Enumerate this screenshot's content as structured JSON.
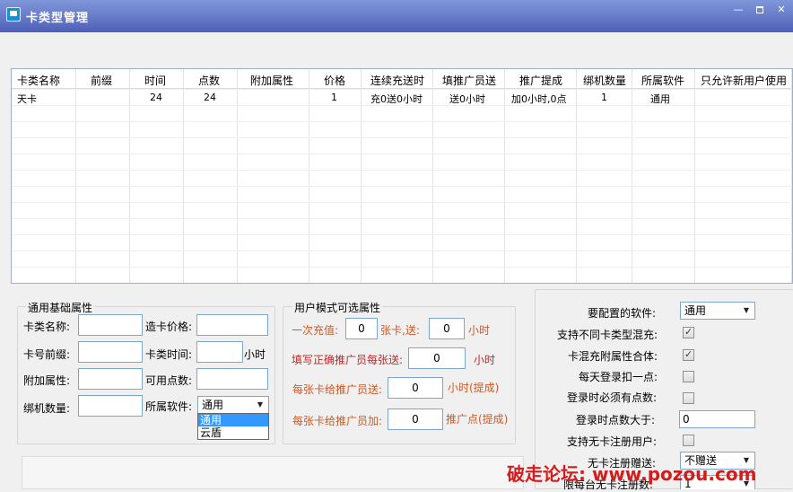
{
  "window": {
    "title": "卡类型管理",
    "min_glyph": "—",
    "close_glyph": "✕"
  },
  "grid": {
    "columns": [
      "卡类名称",
      "前缀",
      "时间",
      "点数",
      "附加属性",
      "价格",
      "连续充送时",
      "填推广员送",
      "推广提成",
      "绑机数量",
      "所属软件",
      "只允许新用户使用"
    ],
    "rows": [
      [
        "天卡",
        "",
        "24",
        "24",
        "",
        "1",
        "充0送0小时",
        "送0小时",
        "加0小时,0点",
        "1",
        "通用",
        ""
      ]
    ]
  },
  "basic": {
    "title": "通用基础属性",
    "card_name_label": "卡类名称:",
    "card_name_value": "",
    "price_label": "造卡价格:",
    "price_value": "",
    "prefix_label": "卡号前缀:",
    "prefix_value": "",
    "time_label": "卡类时间:",
    "time_value": "",
    "time_unit": "小时",
    "attr_label": "附加属性:",
    "attr_value": "",
    "points_label": "可用点数:",
    "points_value": "",
    "bind_label": "绑机数量:",
    "bind_value": "",
    "software_label": "所属软件:",
    "software_value": "通用",
    "software_options": [
      "通用",
      "云盾"
    ]
  },
  "user_mode": {
    "title": "用户模式可选属性",
    "recharge_label": "一次充值:",
    "recharge_value": "0",
    "recharge_mid": "张卡,送:",
    "recharge_gift": "0",
    "recharge_unit": "小时",
    "promoter_label": "填写正确推广员每张送:",
    "promoter_value": "0",
    "promoter_unit": "小时",
    "promo_time_label": "每张卡给推广员送:",
    "promo_time_value": "0",
    "promo_time_unit": "小时(提成)",
    "promo_points_label": "每张卡给推广员加:",
    "promo_points_value": "0",
    "promo_points_unit": "推广点(提成)"
  },
  "right": {
    "software_label": "要配置的软件:",
    "software_value": "通用",
    "mix_label": "支持不同卡类型混充:",
    "mix_checked": true,
    "merge_label": "卡混充附属性合体:",
    "merge_checked": true,
    "daily_label": "每天登录扣一点:",
    "daily_checked": false,
    "login_points_label": "登录时必须有点数:",
    "login_points_checked": false,
    "min_points_label": "登录时点数大于:",
    "min_points_value": "0",
    "nocard_label": "支持无卡注册用户:",
    "nocard_checked": false,
    "gift_label": "无卡注册赠送:",
    "gift_value": "不赠送",
    "limit_label": "限每台无卡注册数:",
    "limit_value": "1"
  },
  "watermark": "破走论坛: www.pozou.com"
}
